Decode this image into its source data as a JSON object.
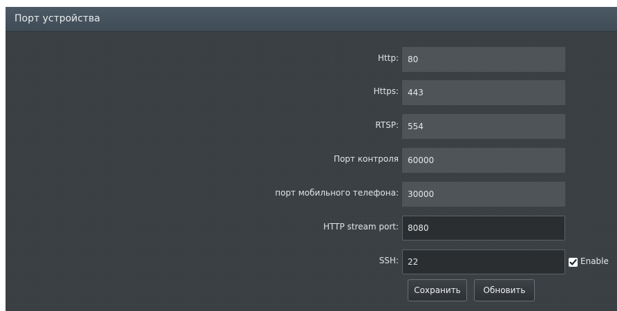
{
  "panel": {
    "title": "Порт устройства"
  },
  "fields": [
    {
      "label": "Http:",
      "value": "80"
    },
    {
      "label": "Https:",
      "value": "443"
    },
    {
      "label": "RTSP:",
      "value": "554"
    },
    {
      "label": "Порт контроля",
      "value": "60000"
    },
    {
      "label": "порт мобильного телефона:",
      "value": "30000"
    },
    {
      "label": "HTTP stream port:",
      "value": "8080"
    },
    {
      "label": "SSH:",
      "value": "22"
    }
  ],
  "ssh_enable": {
    "label": "Enable",
    "checked": true
  },
  "buttons": {
    "save_label": "Сохранить",
    "refresh_label": "Обновить"
  }
}
